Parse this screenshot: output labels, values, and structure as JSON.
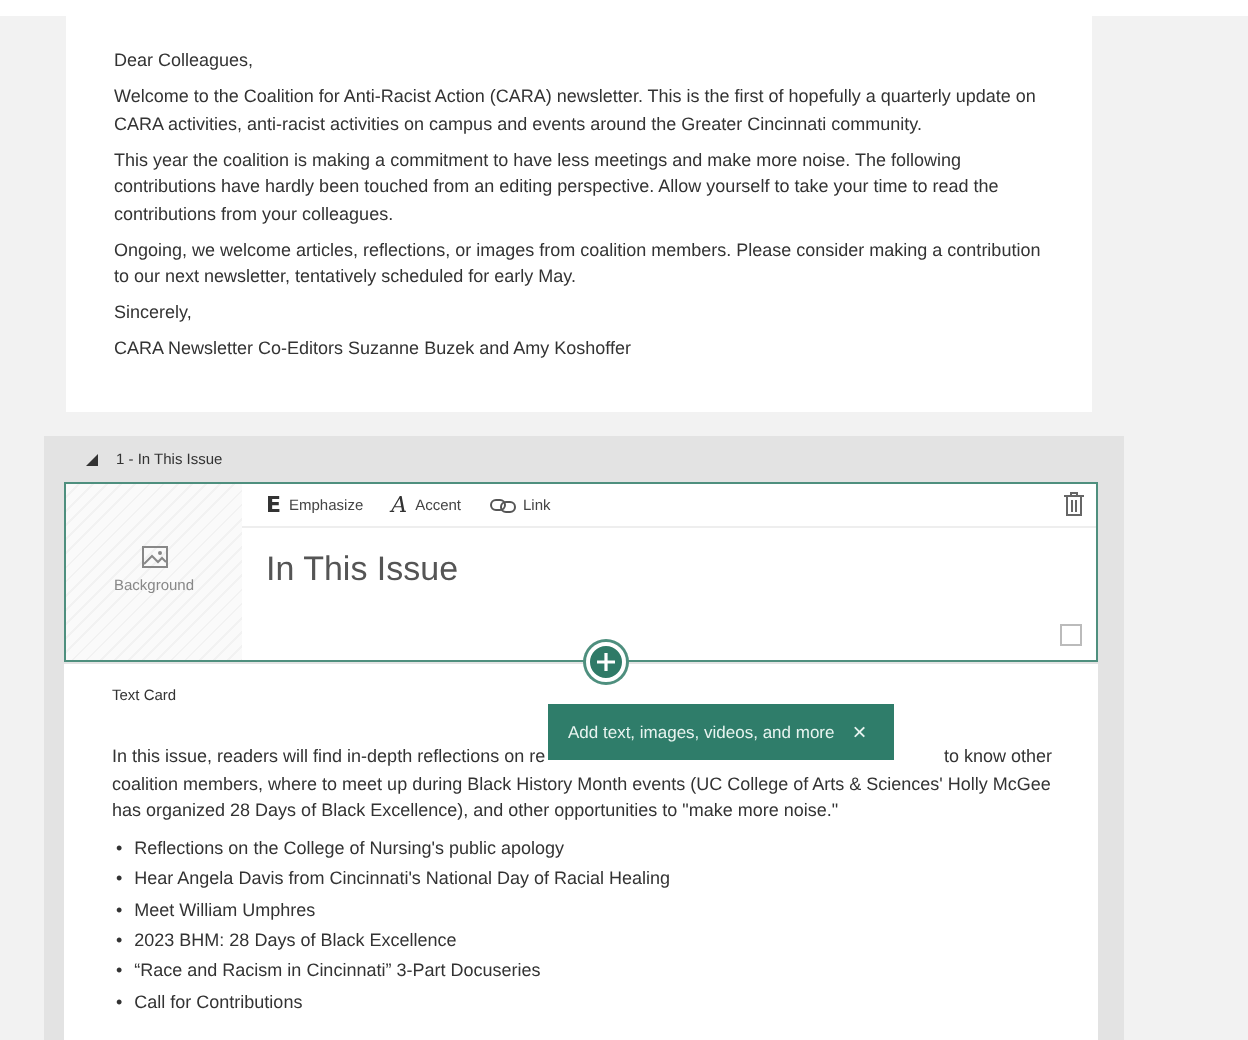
{
  "letter": {
    "paragraphs": [
      "Dear Colleagues,",
      "Welcome to the Coalition for Anti-Racist Action (CARA) newsletter. This is the first of hopefully a quarterly update on CARA activities, anti-racist activities on campus and events around the Greater Cincinnati community.",
      "This year the coalition is making a commitment to have less meetings and make more noise. The following contributions have hardly been touched from an editing perspective. Allow yourself to take your time to read the contributions from your colleagues.",
      "Ongoing, we welcome articles, reflections, or images from coalition members. Please consider making a contribution to our next newsletter, tentatively scheduled for early May.",
      "Sincerely,",
      "CARA Newsletter Co-Editors Suzanne Buzek and Amy Koshoffer"
    ]
  },
  "section": {
    "title": "1 - In This Issue",
    "expanded": true,
    "heading_card": {
      "background_label": "Background",
      "toolbar": [
        {
          "kind": "emphasize",
          "icon": "E",
          "label": "Emphasize"
        },
        {
          "kind": "accent",
          "icon": "A",
          "label": "Accent"
        },
        {
          "kind": "link",
          "label": "Link"
        }
      ],
      "heading": "In This Issue",
      "checked": false
    },
    "text_card": {
      "label": "Text Card",
      "paragraph_start": "In this issue, readers will find in-depth reflections on re",
      "paragraph_line_end": "to know other",
      "paragraph_rest": "coalition members, where to meet up during Black History Month events (UC College of Arts & Sciences'",
      "link": "Holly McGee",
      "paragraph_end": "has organized 28 Days of Black Excellence), and other opportunities to \"make more noise.\"",
      "bullets": [
        {
          "marker": "•",
          "text": "Reflections on the College of Nursing's public apology"
        },
        {
          "marker": "•",
          "text": "Hear Angela Davis from Cincinnati's National Day of Racial Healing"
        },
        {
          "marker": "•",
          "text": "Meet William Umphres"
        },
        {
          "marker": "•",
          "text": "2023 BHM: 28 Days of Black Excellence"
        },
        {
          "marker": "•",
          "text": "“Race and Racism in Cincinnati” 3-Part Docuseries"
        },
        {
          "marker": "•",
          "text": "Call for Contributions"
        }
      ]
    },
    "tooltip": {
      "text": "Add text, images, videos, and more",
      "close": "×"
    }
  }
}
